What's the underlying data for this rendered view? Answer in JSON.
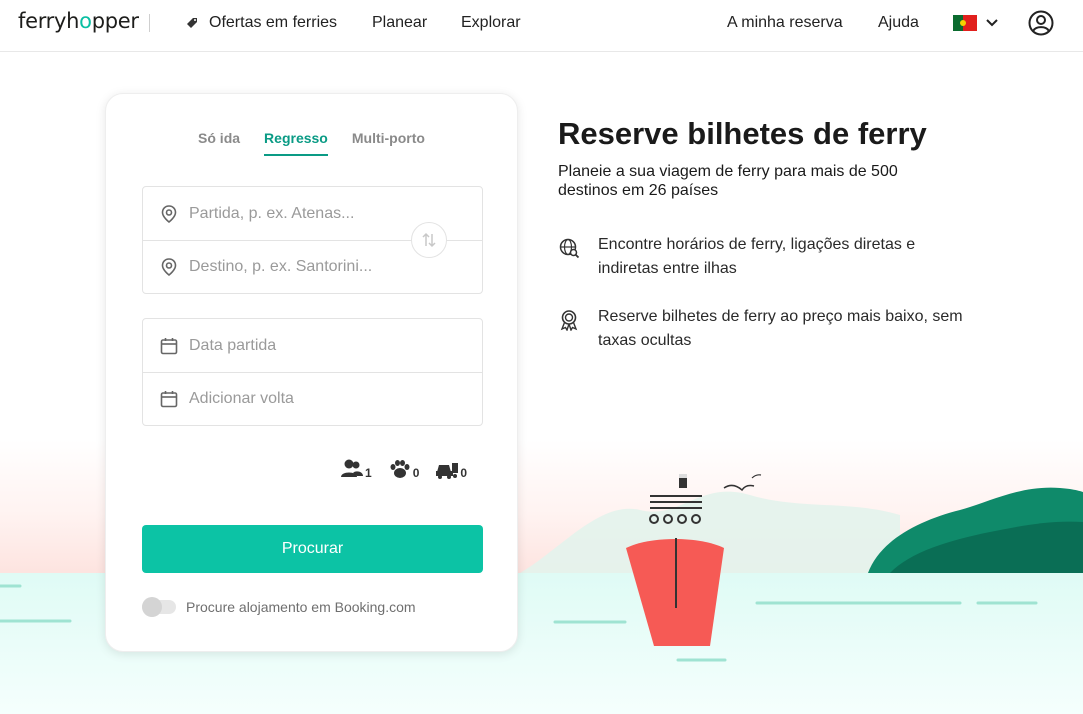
{
  "brand": {
    "logo_text_pre": "ferryh",
    "logo_text_post": "pper"
  },
  "nav": {
    "offers": "Ofertas em ferries",
    "plan": "Planear",
    "explore": "Explorar",
    "my_booking": "A minha reserva",
    "help": "Ajuda"
  },
  "tabs": [
    {
      "label": "Só ida"
    },
    {
      "label": "Regresso"
    },
    {
      "label": "Multi-porto"
    }
  ],
  "form": {
    "departure_placeholder": "Partida, p. ex. Atenas...",
    "destination_placeholder": "Destino, p. ex. Santorini...",
    "date_departure": "Data partida",
    "date_return": "Adicionar volta",
    "passengers": "1",
    "pets": "0",
    "vehicles": "0",
    "search_label": "Procurar",
    "booking_toggle_label": "Procure alojamento em Booking.com"
  },
  "hero": {
    "title": "Reserve bilhetes de ferry",
    "subtitle": "Planeie a sua viagem de ferry para mais de 500 destinos em 26 países",
    "features": [
      {
        "text": "Encontre horários de ferry, ligações diretas e indiretas entre ilhas"
      },
      {
        "text": "Reserve bilhetes de ferry ao preço mais baixo, sem taxas ocultas"
      }
    ]
  },
  "colors": {
    "accent": "#0cc3a5",
    "tab_active": "#0a9b85",
    "ship": "#f65a55",
    "island": "#0f8a6a"
  }
}
